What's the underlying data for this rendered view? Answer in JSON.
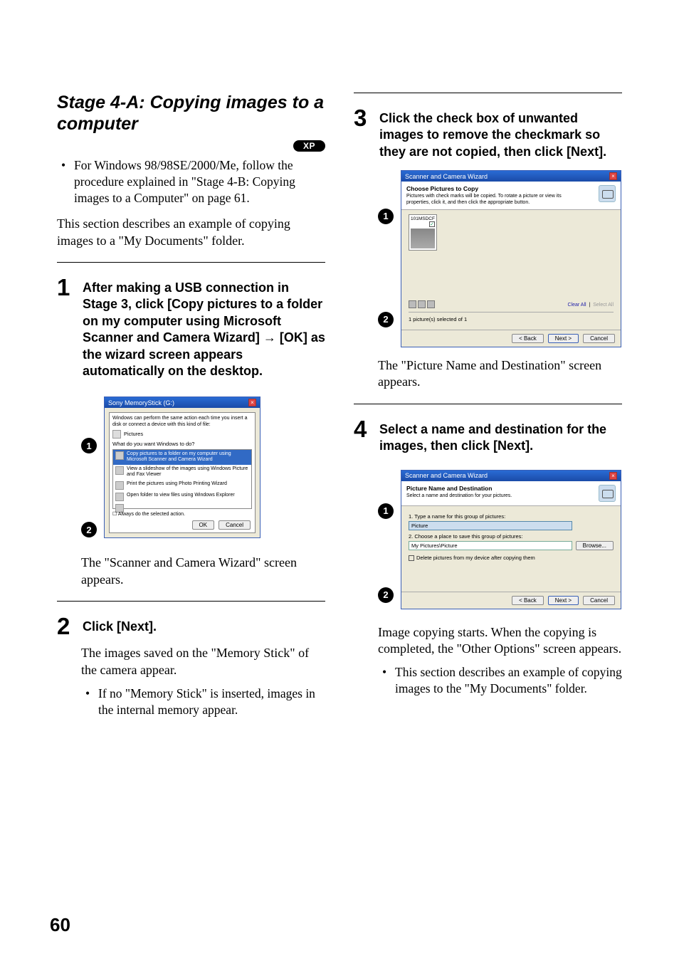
{
  "page_number": "60",
  "left_col": {
    "title": "Stage 4-A: Copying images to a computer",
    "badge": "XP",
    "bullet_os": "For Windows 98/98SE/2000/Me, follow the procedure explained in \"Stage 4-B: Copying images to a Computer\" on page 61.",
    "intro": "This section describes an example of copying images to a \"My Documents\" folder.",
    "step1_text_a": "After making a USB connection in Stage 3, click [Copy pictures to a folder on my computer using Microsoft Scanner and Camera Wizard] ",
    "step1_text_b": " [OK] as the wizard screen appears automatically on the desktop.",
    "step1_after": "The \"Scanner and Camera Wizard\" screen appears.",
    "step2_text": "Click [Next].",
    "step2_body": "The images saved on the \"Memory Stick\" of the camera appear.",
    "step2_bullet": "If no \"Memory Stick\" is inserted, images in the internal memory appear.",
    "autoplay": {
      "title": "Sony MemoryStick (G:)",
      "intro": "Windows can perform the same action each time you insert a disk or connect a device with this kind of file:",
      "pictures": "Pictures",
      "prompt": "What do you want Windows to do?",
      "opt1": "Copy pictures to a folder on my computer using Microsoft Scanner and Camera Wizard",
      "opt2": "View a slideshow of the images using Windows Picture and Fax Viewer",
      "opt3": "Print the pictures using Photo Printing Wizard",
      "opt4": "Open folder to view files using Windows Explorer",
      "always": "Always do the selected action.",
      "ok": "OK",
      "cancel": "Cancel"
    }
  },
  "right_col": {
    "step3_text": "Click the check box of unwanted images to remove the checkmark so they are not copied, then click [Next].",
    "step3_after": "The \"Picture Name and Destination\" screen appears.",
    "step4_text": "Select a name and destination for the images, then click [Next].",
    "step4_body": "Image copying starts. When the copying is completed, the \"Other Options\" screen appears.",
    "step4_bullet": "This section describes an example of copying images to the \"My Documents\" folder.",
    "wiz3": {
      "title": "Scanner and Camera Wizard",
      "h1": "Choose Pictures to Copy",
      "h2": "Pictures with check marks will be copied. To rotate a picture or view its properties, click it, and then click the appropriate button.",
      "thumb_label": "101MSDCF",
      "clear_all": "Clear All",
      "select_all": "Select All",
      "status": "1 picture(s) selected of 1",
      "back": "< Back",
      "next": "Next >",
      "cancel": "Cancel"
    },
    "wiz4": {
      "title": "Scanner and Camera Wizard",
      "h1": "Picture Name and Destination",
      "h2": "Select a name and destination for your pictures.",
      "l1": "1.  Type a name for this group of pictures:",
      "v1": "Picture",
      "l2": "2.  Choose a place to save this group of pictures:",
      "v2": "My Pictures\\Picture",
      "browse": "Browse...",
      "del": "Delete pictures from my device after copying them",
      "back": "< Back",
      "next": "Next >",
      "cancel": "Cancel"
    }
  }
}
